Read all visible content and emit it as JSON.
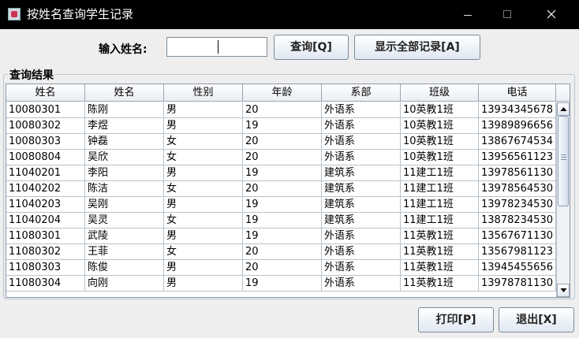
{
  "window": {
    "title": "按姓名查询学生记录"
  },
  "search": {
    "label": "输入姓名:",
    "value": "",
    "query_button": "查询[Q]",
    "show_all_button": "显示全部记录[A]"
  },
  "results": {
    "group_title": "查询结果",
    "columns": [
      "姓名",
      "姓名",
      "性别",
      "年龄",
      "系部",
      "班级",
      "电话"
    ],
    "rows": [
      [
        "10080301",
        "陈刚",
        "男",
        "20",
        "外语系",
        "10英教1班",
        "13934345678"
      ],
      [
        "10080302",
        "李煜",
        "男",
        "19",
        "外语系",
        "10英教1班",
        "13989896656"
      ],
      [
        "10080303",
        "钟磊",
        "女",
        "20",
        "外语系",
        "10英教1班",
        "13867674534"
      ],
      [
        "10080804",
        "吴欣",
        "女",
        "20",
        "外语系",
        "10英教1班",
        "13956561123"
      ],
      [
        "11040201",
        "李阳",
        "男",
        "19",
        "建筑系",
        "11建工1班",
        "13978561130"
      ],
      [
        "11040202",
        "陈洁",
        "女",
        "20",
        "建筑系",
        "11建工1班",
        "13978564530"
      ],
      [
        "11040203",
        "吴刚",
        "男",
        "19",
        "建筑系",
        "11建工1班",
        "13978234530"
      ],
      [
        "11040204",
        "吴灵",
        "女",
        "19",
        "建筑系",
        "11建工1班",
        "13878234530"
      ],
      [
        "11080301",
        "武陵",
        "男",
        "19",
        "外语系",
        "11英教1班",
        "13567671130"
      ],
      [
        "11080302",
        "王菲",
        "女",
        "20",
        "外语系",
        "11英教1班",
        "13567981123"
      ],
      [
        "11080303",
        "陈俊",
        "男",
        "20",
        "外语系",
        "11英教1班",
        "13945455656"
      ],
      [
        "11080304",
        "向刚",
        "男",
        "19",
        "外语系",
        "11英教1班",
        "13978781130"
      ]
    ]
  },
  "footer": {
    "print_button": "打印[P]",
    "exit_button": "退出[X]"
  },
  "icons": {
    "app": "java-app-icon",
    "close": "close-icon",
    "minimize": "minimize-icon",
    "maximize": "maximize-icon",
    "scroll_up": "arrow-up-icon",
    "scroll_down": "arrow-down-icon"
  },
  "colors": {
    "titlebar": "#000000",
    "window_bg": "#eeeeee",
    "table_bg": "#ffffff",
    "grid_line": "#b8c2cd",
    "button_gradient_end": "#dfe8f2"
  }
}
